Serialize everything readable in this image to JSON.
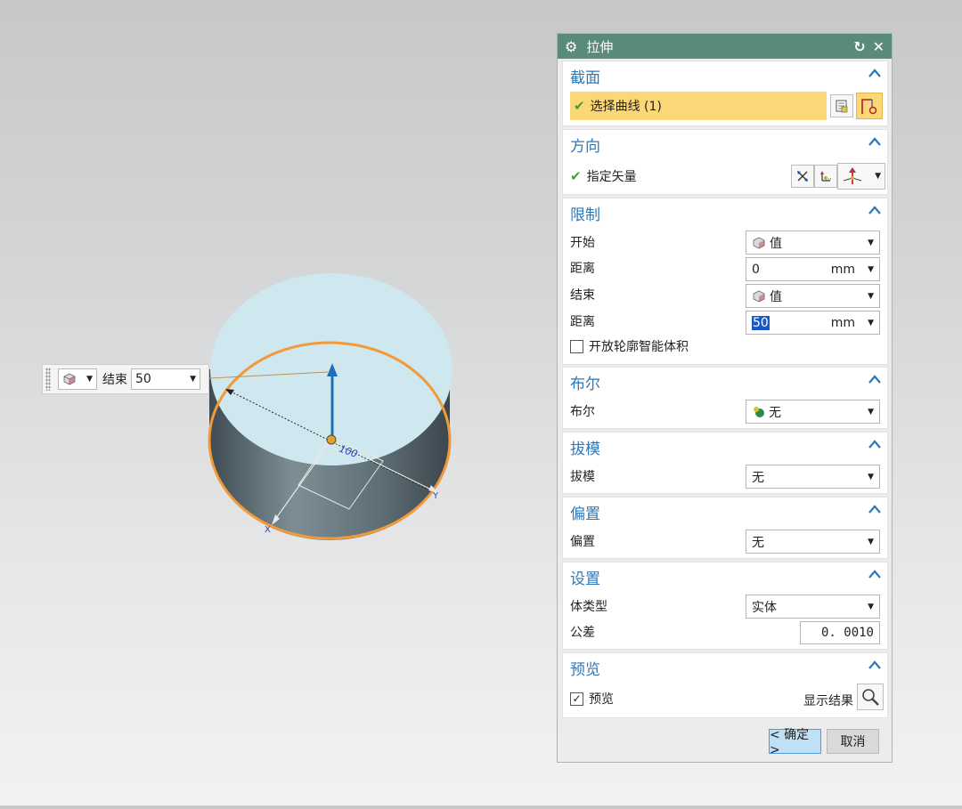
{
  "dialog": {
    "title": "拉伸",
    "icons": {
      "settings": "gear-icon",
      "reset": "reset-icon",
      "close": "close-icon"
    }
  },
  "section": {
    "header": "截面",
    "select_curve": "选择曲线 (1)"
  },
  "direction": {
    "header": "方向",
    "specify_vector": "指定矢量"
  },
  "limits": {
    "header": "限制",
    "start_label": "开始",
    "start_value": "值",
    "start_distance_label": "距离",
    "start_distance": "0",
    "start_unit": "mm",
    "end_label": "结束",
    "end_value": "值",
    "end_distance_label": "距离",
    "end_distance": "50",
    "end_unit": "mm",
    "open_profile_label": "开放轮廓智能体积",
    "open_profile_checked": false
  },
  "boolean": {
    "header": "布尔",
    "label": "布尔",
    "value": "无"
  },
  "draft": {
    "header": "拔模",
    "label": "拔模",
    "value": "无"
  },
  "offset": {
    "header": "偏置",
    "label": "偏置",
    "value": "无"
  },
  "settings": {
    "header": "设置",
    "body_type_label": "体类型",
    "body_type": "实体",
    "tolerance_label": "公差",
    "tolerance": "0. 0010"
  },
  "preview": {
    "header": "预览",
    "preview_label": "预览",
    "preview_checked": true,
    "show_result_label": "显示结果"
  },
  "buttons": {
    "ok": "< 确定 >",
    "cancel": "取消"
  },
  "viewport": {
    "handle_label": "结束",
    "handle_value": "50",
    "axis_x": "X",
    "axis_y": "Y",
    "dim_text": "100"
  },
  "colors": {
    "title_bar": "#5a8a7a",
    "section_header": "#2f78b7",
    "selection_highlight": "#fbd777",
    "edge_highlight": "#f29a3a",
    "cylinder_top": "#cfe7ef"
  }
}
